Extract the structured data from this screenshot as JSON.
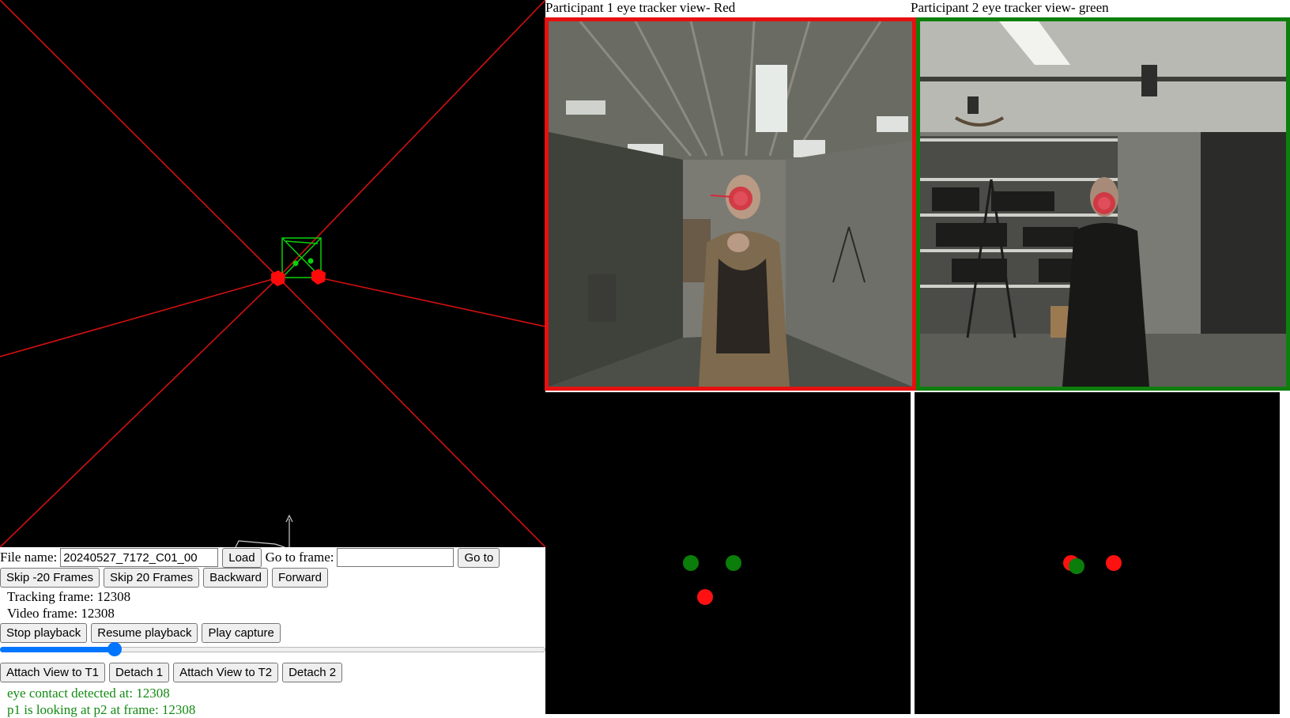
{
  "views": {
    "p1_title": "Participant 1 eye tracker view- Red",
    "p2_title": "Participant 2 eye tracker view- green"
  },
  "controls": {
    "file_name_label": "File name:",
    "file_name_value": "20240527_7172_C01_00",
    "load_label": "Load",
    "goto_frame_label": "Go to frame:",
    "goto_frame_value": "",
    "goto_label": "Go to",
    "skip_back_label": "Skip -20 Frames",
    "skip_fwd_label": "Skip 20 Frames",
    "backward_label": "Backward",
    "forward_label": "Forward",
    "tracking_frame": "Tracking frame: 12308",
    "video_frame": "Video frame: 12308",
    "stop_playback_label": "Stop playback",
    "resume_playback_label": "Resume playback",
    "play_capture_label": "Play capture",
    "timeline_progress": 0.21,
    "attach_t1_label": "Attach View to T1",
    "detach1_label": "Detach 1",
    "attach_t2_label": "Attach View to T2",
    "detach2_label": "Detach 2"
  },
  "status": {
    "eye_contact": "eye contact detected at: 12308",
    "p1_looking": "p1 is looking at p2 at frame: 12308"
  },
  "colors": {
    "p1_color": "#e61010",
    "p2_color": "#0d7f0d",
    "gaze_green": "#0a7d0a",
    "gaze_red": "#ff1111",
    "slider_accent": "#0075ff"
  }
}
